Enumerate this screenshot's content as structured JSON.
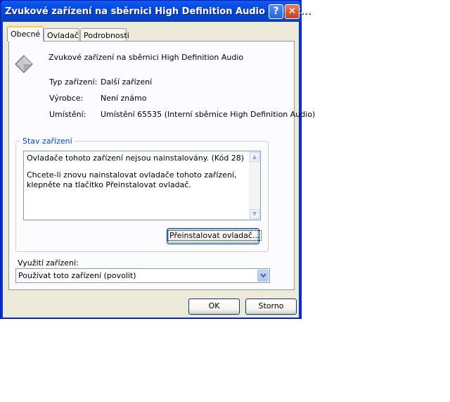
{
  "window": {
    "title": "Zvukové zařízení na sběrnici High Definition Audio - vlast...",
    "help_glyph": "?",
    "close_glyph": "✕"
  },
  "tabs": [
    {
      "label": "Obecné",
      "active": true
    },
    {
      "label": "Ovladač",
      "active": false
    },
    {
      "label": "Podrobnosti",
      "active": false
    }
  ],
  "device": {
    "icon": "speaker-device-icon",
    "name": "Zvukové zařízení na sběrnici High Definition Audio",
    "type_label": "Typ zařízení:",
    "type_value": "Další zařízení",
    "manufacturer_label": "Výrobce:",
    "manufacturer_value": "Není známo",
    "location_label": "Umístění:",
    "location_value": "Umístění 65535 (Interní sběrnice High Definition Audio)"
  },
  "status": {
    "group_label": "Stav zařízení",
    "line1": "Ovladače tohoto zařízení nejsou nainstalovány. (Kód 28)",
    "line2": "Chcete-li znovu nainstalovat ovladače tohoto zařízení, klepněte na tlačítko Přeinstalovat ovladač.",
    "reinstall_button": "Přeinstalovat ovladač..."
  },
  "usage": {
    "label": "Využití zařízení:",
    "selected": "Používat toto zařízení (povolit)"
  },
  "footer": {
    "ok": "OK",
    "cancel": "Storno"
  },
  "colors": {
    "titlebar": "#0548d8",
    "group_label": "#0046d5",
    "dialog_bg": "#ece9d8"
  }
}
